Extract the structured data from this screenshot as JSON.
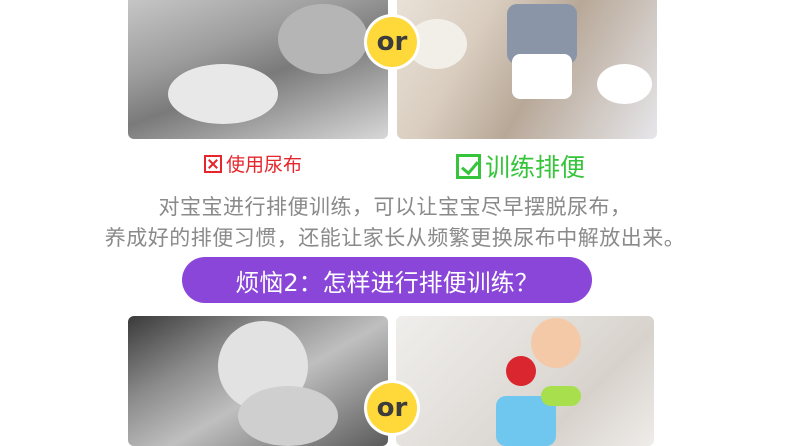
{
  "photos": {
    "top_left": "baby-lying-diaper-photo",
    "top_right": "child-potty-training-photo",
    "bottom_left": "baby-held-photo",
    "bottom_right": "baby-on-toilet-ladder-photo"
  },
  "or_label": "or",
  "option_diaper": "使用尿布",
  "option_training": "训练排便",
  "description": {
    "line1": "对宝宝进行排便训练，可以让宝宝尽早摆脱尿布，",
    "line2": "养成好的排便习惯，还能让家长从频繁更换尿布中解放出来。"
  },
  "banner": "烦恼2：怎样进行排便训练？",
  "colors": {
    "diaper_red": "#e5262c",
    "training_green": "#36c43a",
    "banner_purple": "#8a45d9",
    "or_yellow": "#ffd83a",
    "body_gray": "#8a8a8a"
  },
  "icons": {
    "diaper": "x-box-icon",
    "training": "checkbox-icon"
  }
}
